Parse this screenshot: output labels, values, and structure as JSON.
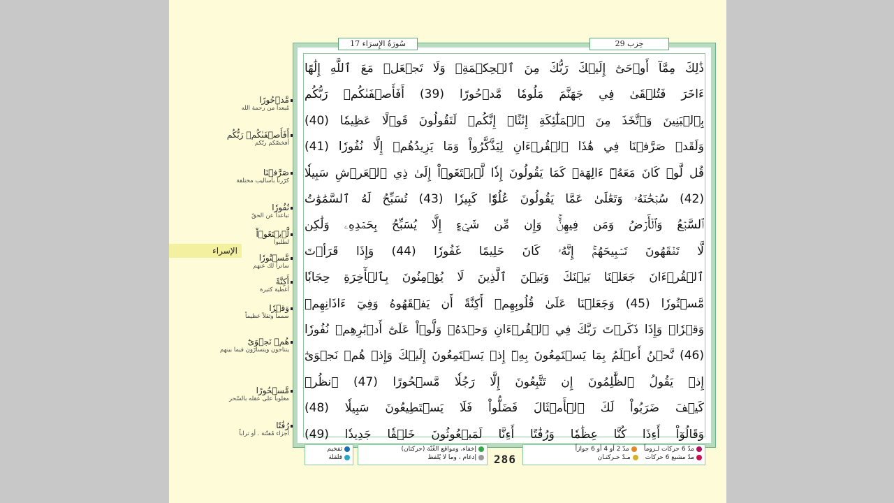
{
  "header": {
    "surah": "سُورَةُ الإِسرَاء 17",
    "hizb": "حِزب 29"
  },
  "surah_label": "الإسراء",
  "page_number": "286",
  "lines": [
    "ذَٰلِكَ مِمَّآ أَوۡحَىٰٓ إِلَيۡكَ رَبُّكَ مِنَ ٱلۡحِكۡمَةِۗ وَلَا تَجۡعَلۡ مَعَ ٱللَّهِ إِلَٰهًا",
    "ءَاخَرَ فَتُلۡقَىٰ فِي جَهَنَّمَ مَلُومٗا مَّدۡحُورًا (39) أَفَأَصۡفَىٰكُمۡ رَبُّكُم",
    "بِٱلۡبَنِينَ وَٱتَّخَذَ مِنَ ٱلۡمَلَٰٓئِكَةِ إِنَٰثًاۚ إِنَّكُمۡ لَتَقُولُونَ قَوۡلًا عَظِيمٗا (40)",
    "وَلَقَدۡ صَرَّفۡنَا فِي هَٰذَا ٱلۡقُرۡءَانِ لِيَذَّكَّرُواْ وَمَا يَزِيدُهُمۡ إِلَّا نُفُورٗا (41)",
    "قُل لَّوۡ كَانَ مَعَهُۥٓ ءَالِهَةٞ كَمَا يَقُولُونَ إِذٗا لَّٱبۡتَغَوۡاْ إِلَىٰ ذِي ٱلۡعَرۡشِ سَبِيلٗا",
    "(42) سُبۡحَٰنَهُۥ وَتَعَٰلَىٰ عَمَّا يَقُولُونَ عُلُوّٗا كَبِيرٗا (43) تُسَبِّحُ لَهُ ٱلسَّمَٰوَٰتُ",
    "ٱلسَّبۡعُ وَٱلۡأَرۡضُ وَمَن فِيهِنَّۚ وَإِن مِّن شَيۡءٍ إِلَّا يُسَبِّحُ بِحَمۡدِهِۦ وَلَٰكِن",
    "لَّا تَفۡقَهُونَ تَسۡبِيحَهُمۡۚ إِنَّهُۥ كَانَ حَلِيمًا غَفُورٗا (44) وَإِذَا قَرَأۡتَ",
    "ٱلۡقُرۡءَانَ جَعَلۡنَا بَيۡنَكَ وَبَيۡنَ ٱلَّذِينَ لَا يُؤۡمِنُونَ بِٱلۡأٓخِرَةِ حِجَابٗا",
    "مَّسۡتُورٗا (45) وَجَعَلۡنَا عَلَىٰ قُلُوبِهِمۡ أَكِنَّةً أَن يَفۡقَهُوهُ وَفِيٓ ءَاذَانِهِمۡ",
    "وَقۡرٗاۚ وَإِذَا ذَكَرۡتَ رَبَّكَ فِي ٱلۡقُرۡءَانِ وَحۡدَهُۥ وَلَّوۡاْ عَلَىٰٓ أَدۡبَٰرِهِمۡ نُفُورٗا",
    "(46) نَّحۡنُ أَعۡلَمُ بِمَا يَسۡتَمِعُونَ بِهِۦٓ إِذۡ يَسۡتَمِعُونَ إِلَيۡكَ وَإِذۡ هُمۡ نَجۡوَىٰٓ",
    "إِذۡ يَقُولُ ٱلظَّٰلِمُونَ إِن تَتَّبِعُونَ إِلَّا رَجُلٗا مَّسۡحُورًا (47) ٱنظُرۡ",
    "كَيۡفَ ضَرَبُواْ لَكَ ٱلۡأَمۡثَالَ فَضَلُّواْ فَلَا يَسۡتَطِيعُونَ سَبِيلٗا (48)",
    "وَقَالُوٓاْ أَءِذَا كُنَّا عِظَٰمٗا وَرُفَٰتًا أَءِنَّا لَمَبۡعُوثُونَ خَلۡقٗا جَدِيدٗا (49)"
  ],
  "glossary": [
    {
      "word": "مَّدۡحُورًا",
      "meaning": "مُبعداً من رحمة الله"
    },
    {
      "word": "أَفَأَصۡفَىٰكُمۡ رَبُّكُم",
      "meaning": "أفخصّكم ربّكم"
    },
    {
      "word": "صَرَّفۡنَا",
      "meaning": "كرّرنا بأساليب مختلفة"
    },
    {
      "word": "نُفُورٗا",
      "meaning": "تباعداً عن الحقّ"
    },
    {
      "word": "لَّٱبۡتَغَوۡاْ",
      "meaning": "لطلبوا"
    },
    {
      "word": "مَّسۡتُورٗا",
      "meaning": "ساتراً لك عنهم"
    },
    {
      "word": "أَكِنَّةً",
      "meaning": "أغطية كثيرة"
    },
    {
      "word": "وَقۡرٗا",
      "meaning": "صمماً وثقلاً عظيماً"
    },
    {
      "word": "هُمۡ نَجۡوَىٰٓ",
      "meaning": "يتناجون ويتسارّون فيما بينهم"
    },
    {
      "word": "مَّسۡحُورًا",
      "meaning": "مغلوباً على عقله بالسّحر"
    },
    {
      "word": "رُفَٰتًا",
      "meaning": "أجزاء مُفتّتة . أو تراباً"
    }
  ],
  "legend": {
    "right_box": [
      {
        "label": "مدّ 6 حركات لـزوماً",
        "color": "#b0125c"
      },
      {
        "label": "مدّ 2 أو 4 أو 6 جوازاً",
        "color": "#e08a2a"
      },
      {
        "label": "مدّ مشبع 6 حركات",
        "color": "#c8104f"
      },
      {
        "label": "مـدّ حـركتـان",
        "color": "#d9b02a"
      }
    ],
    "mid_box": [
      {
        "label": "إخفاء، ومواقع الغُنّة (حركتان)",
        "color": "#35a84a"
      },
      {
        "label": "إدغام ، وما لا يُلفظ",
        "color": "#9a9a9a"
      }
    ],
    "left_box": [
      {
        "label": "تفخيم",
        "color": "#1a6fb0"
      },
      {
        "label": "قلقلة",
        "color": "#2aa6c8"
      }
    ]
  }
}
